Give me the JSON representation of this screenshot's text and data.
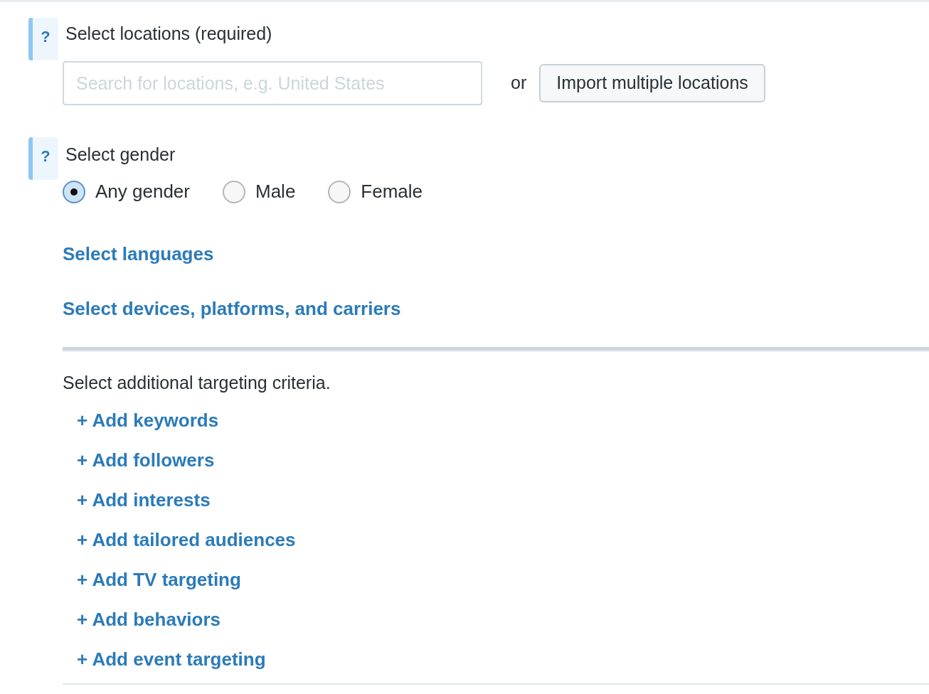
{
  "locations": {
    "help": "?",
    "title": "Select locations (required)",
    "placeholder": "Search for locations, e.g. United States",
    "or": "or",
    "import_button": "Import multiple locations"
  },
  "gender": {
    "help": "?",
    "title": "Select gender",
    "options": [
      {
        "label": "Any gender",
        "selected": true
      },
      {
        "label": "Male",
        "selected": false
      },
      {
        "label": "Female",
        "selected": false
      }
    ]
  },
  "links": [
    "Select languages",
    "Select devices, platforms, and carriers"
  ],
  "additional": {
    "title": "Select additional targeting criteria.",
    "items": [
      "+ Add keywords",
      "+ Add followers",
      "+ Add interests",
      "+ Add tailored audiences",
      "+ Add TV targeting",
      "+ Add behaviors",
      "+ Add event targeting"
    ]
  }
}
